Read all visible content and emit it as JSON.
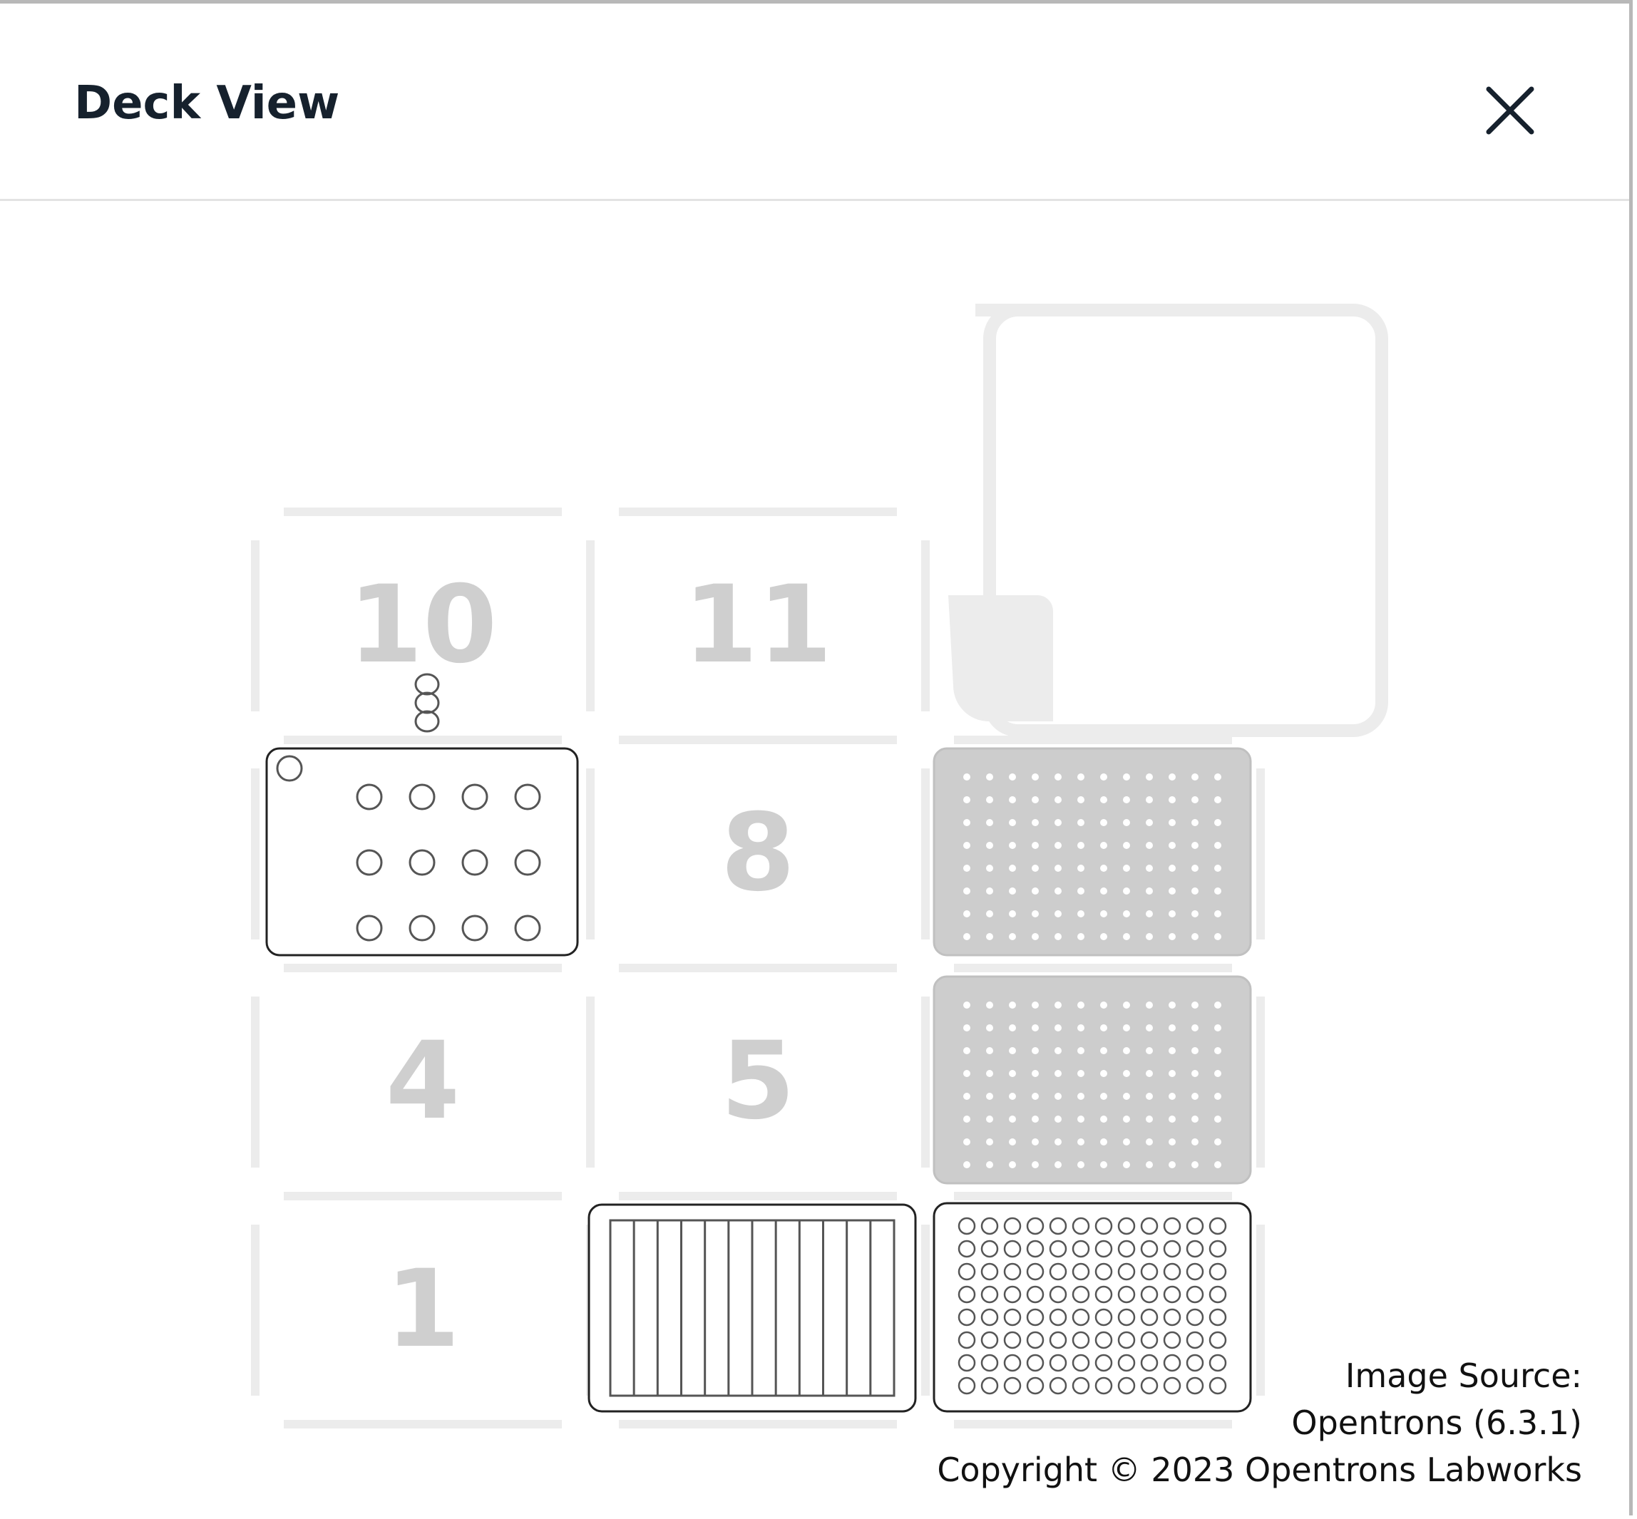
{
  "modal": {
    "title": "Deck View",
    "close_icon": "close-icon"
  },
  "deck": {
    "slots": [
      {
        "id": "10",
        "label": "10"
      },
      {
        "id": "11",
        "label": "11"
      },
      {
        "id": "7",
        "label": "",
        "labware": "tube-rack-12"
      },
      {
        "id": "8",
        "label": "8"
      },
      {
        "id": "9",
        "label": "",
        "labware": "tip-rack-96"
      },
      {
        "id": "4",
        "label": "4"
      },
      {
        "id": "5",
        "label": "5"
      },
      {
        "id": "6",
        "label": "",
        "labware": "tip-rack-96"
      },
      {
        "id": "1",
        "label": "1"
      },
      {
        "id": "2",
        "label": "",
        "labware": "reservoir-12"
      },
      {
        "id": "3",
        "label": "",
        "labware": "well-plate-96"
      },
      {
        "id": "12",
        "label": "",
        "labware": "trash-bin"
      }
    ],
    "colors": {
      "slot_outline": "#ececec",
      "slot_label": "#cfcfcf",
      "labware_outline": "#222222",
      "tiprack_fill": "#cdcdcd",
      "trash": "#ececec"
    }
  },
  "footer": {
    "line1": "Image Source:",
    "line2": "Opentrons (6.3.1)",
    "line3": "Copyright © 2023 Opentrons Labworks"
  }
}
